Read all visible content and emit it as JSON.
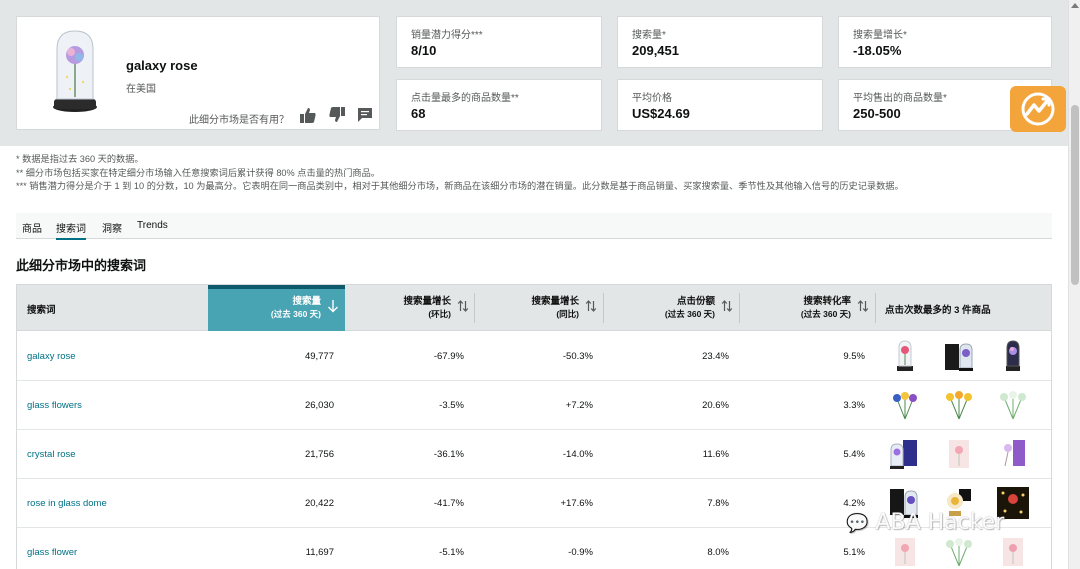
{
  "product": {
    "name": "galaxy rose",
    "location": "在美国",
    "helpful_question": "此细分市场是否有用？"
  },
  "metrics": [
    {
      "label": "销量潜力得分***",
      "value": "8/10"
    },
    {
      "label": "搜索量*",
      "value": "209,451"
    },
    {
      "label": "搜索量增长*",
      "value": "-18.05%"
    },
    {
      "label": "点击量最多的商品数量**",
      "value": "68"
    },
    {
      "label": "平均价格",
      "value": "US$24.69"
    },
    {
      "label": "平均售出的商品数量*",
      "value": "250-500"
    }
  ],
  "footnotes": [
    "* 数据是指过去 360 天的数据。",
    "** 细分市场包括买家在特定细分市场输入任意搜索词后累计获得 80% 点击量的热门商品。",
    "*** 销售潜力得分是介于 1 到 10 的分数，10 为最高分。它表明在同一商品类别中，相对于其他细分市场，新商品在该细分市场的潜在销量。此分数是基于商品销量、买家搜索量、季节性及其他输入信号的历史记录数据。"
  ],
  "tabs": [
    {
      "label": "商品",
      "active": false
    },
    {
      "label": "搜索词",
      "active": true
    },
    {
      "label": "洞察",
      "active": false
    },
    {
      "label": "Trends",
      "active": false
    }
  ],
  "section_title": "此细分市场中的搜索词",
  "table": {
    "columns": [
      {
        "title": "搜索词",
        "sub": ""
      },
      {
        "title": "搜索量",
        "sub": "(过去 360 天)"
      },
      {
        "title": "搜索量增长",
        "sub": "(环比)"
      },
      {
        "title": "搜索量增长",
        "sub": "(同比)"
      },
      {
        "title": "点击份额",
        "sub": "(过去 360 天)"
      },
      {
        "title": "搜索转化率",
        "sub": "(过去 360 天)"
      },
      {
        "title": "点击次数最多的 3 件商品",
        "sub": ""
      }
    ],
    "rows": [
      {
        "term": "galaxy rose",
        "volume": "49,777",
        "qoq": "-67.9%",
        "yoy": "-50.3%",
        "share": "23.4%",
        "conv": "9.5%",
        "thumbs": [
          "rose-dome-icon",
          "black-box-rose-icon",
          "galaxy-dome-icon"
        ]
      },
      {
        "term": "glass flowers",
        "volume": "26,030",
        "qoq": "-3.5%",
        "yoy": "+7.2%",
        "share": "20.6%",
        "conv": "3.3%",
        "thumbs": [
          "mixed-bouquet-icon",
          "yellow-bouquet-icon",
          "green-bouquet-icon"
        ]
      },
      {
        "term": "crystal rose",
        "volume": "21,756",
        "qoq": "-36.1%",
        "yoy": "-14.0%",
        "share": "11.6%",
        "conv": "5.4%",
        "thumbs": [
          "rose-box-icon",
          "pink-rose-icon",
          "purple-rose-box-icon"
        ]
      },
      {
        "term": "rose in glass dome",
        "volume": "20,422",
        "qoq": "-41.7%",
        "yoy": "+17.6%",
        "share": "7.8%",
        "conv": "4.2%",
        "thumbs": [
          "black-box-rose-icon",
          "gold-rose-icon",
          "lights-rose-icon"
        ]
      },
      {
        "term": "glass flower",
        "volume": "11,697",
        "qoq": "-5.1%",
        "yoy": "-0.9%",
        "share": "8.0%",
        "conv": "5.1%",
        "thumbs": [
          "pink-rose-icon",
          "green-bouquet-icon",
          "pink-rose-icon"
        ]
      }
    ]
  },
  "watermark": "ABA Hacker"
}
